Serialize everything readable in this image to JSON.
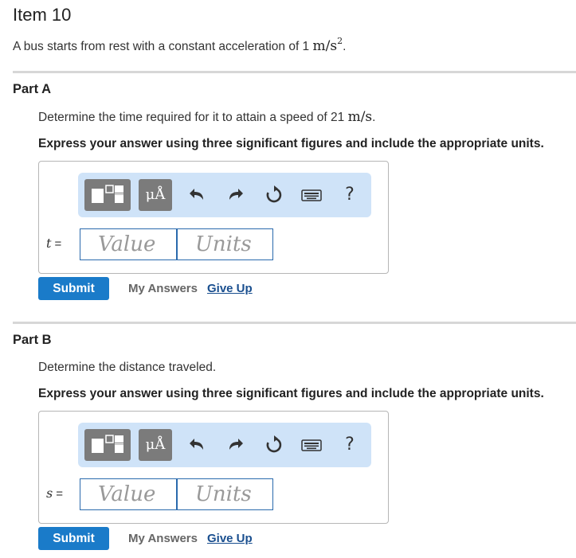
{
  "item_title": "Item 10",
  "intro": {
    "text": "A bus starts from rest with a constant acceleration of 1 ",
    "unit_base": "m/s",
    "unit_exp": "2",
    "end": "."
  },
  "parts": [
    {
      "title": "Part A",
      "prompt_text": "Determine the time required for it to attain a speed of 21 ",
      "prompt_unit": "m/s",
      "prompt_end": ".",
      "instruction": "Express your answer using three significant figures and include the appropriate units.",
      "variable": "t",
      "equals": "=",
      "value_placeholder": "Value",
      "units_placeholder": "Units",
      "submit_label": "Submit",
      "my_answers_label": "My Answers",
      "give_up_label": "Give Up"
    },
    {
      "title": "Part B",
      "prompt_text": "Determine the distance traveled.",
      "prompt_unit": "",
      "prompt_end": "",
      "instruction": "Express your answer using three significant figures and include the appropriate units.",
      "variable": "s",
      "equals": "=",
      "value_placeholder": "Value",
      "units_placeholder": "Units",
      "submit_label": "Submit",
      "my_answers_label": "My Answers",
      "give_up_label": "Give Up"
    }
  ],
  "toolbar": {
    "symbol_button": "μÅ",
    "help_label": "?",
    "icons": [
      "templates-icon",
      "symbols-icon",
      "undo-icon",
      "redo-icon",
      "reset-icon",
      "keyboard-icon",
      "help-icon"
    ]
  },
  "colors": {
    "toolbar_bg": "#cfe3f8",
    "submit_bg": "#1a7bc9",
    "link": "#1a4f8f",
    "input_border": "#2a6aad"
  }
}
